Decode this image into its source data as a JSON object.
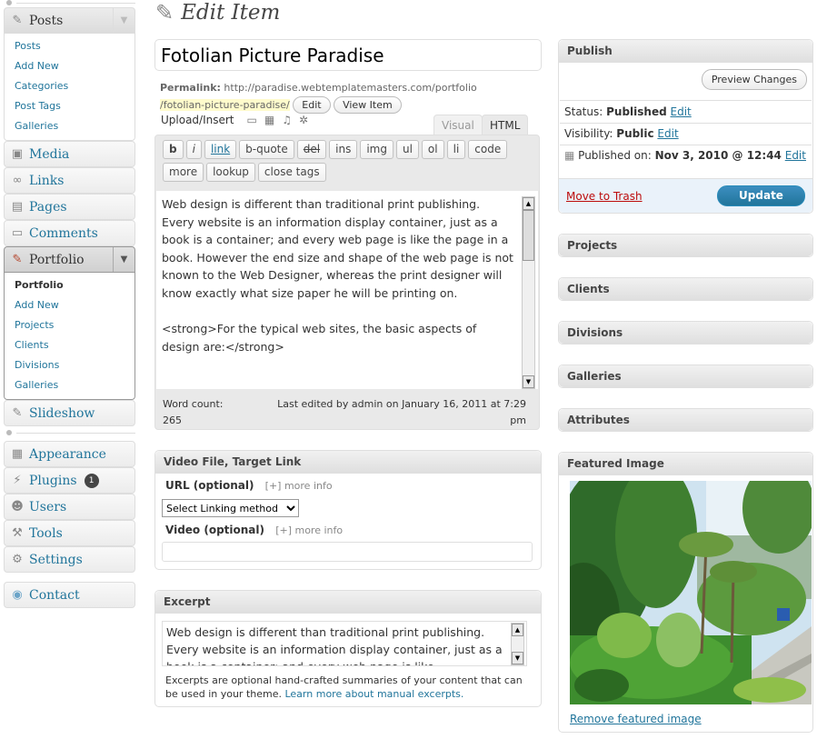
{
  "sidebar": {
    "posts": {
      "label": "Posts",
      "items": [
        "Posts",
        "Add New",
        "Categories",
        "Post Tags",
        "Galleries"
      ]
    },
    "media": "Media",
    "links": "Links",
    "pages": "Pages",
    "comments": "Comments",
    "portfolio": {
      "label": "Portfolio",
      "items": [
        "Portfolio",
        "Add New",
        "Projects",
        "Clients",
        "Divisions",
        "Galleries"
      ]
    },
    "slideshow": "Slideshow",
    "appearance": "Appearance",
    "plugins": "Plugins",
    "plugins_badge": "1",
    "users": "Users",
    "tools": "Tools",
    "settings": "Settings",
    "contact": "Contact"
  },
  "page_title": "Edit Item",
  "post": {
    "title": "Fotolian Picture Paradise",
    "permalink_label": "Permalink:",
    "permalink_base": "http://paradise.webtemplatemasters.com/portfolio",
    "permalink_slug": "/fotolian-picture-paradise/",
    "edit_button": "Edit",
    "view_button": "View Item",
    "upload_insert": "Upload/Insert",
    "tab_visual": "Visual",
    "tab_html": "HTML",
    "quicktags": [
      "b",
      "i",
      "link",
      "b-quote",
      "del",
      "ins",
      "img",
      "ul",
      "ol",
      "li",
      "code",
      "more",
      "lookup",
      "close tags"
    ],
    "content": "Web design is different than traditional print publishing. Every website is an information display container, just as a book is a container; and every web page is like the page in a book. However the end size and shape of the web page is not known to the Web Designer, whereas the print designer will know exactly what size paper he will be printing on.\n\n<strong>For the typical web sites, the basic aspects of design are:</strong>",
    "word_count_label": "Word count:",
    "word_count": "265",
    "last_edited": "Last edited by admin on January 16, 2011 at 7:29 pm"
  },
  "video_box": {
    "title": "Video File, Target Link",
    "url_label": "URL (optional)",
    "url_more": "[+] more info",
    "select_value": "Select Linking method",
    "video_label": "Video (optional)",
    "video_more": "[+] more info"
  },
  "excerpt_box": {
    "title": "Excerpt",
    "text": "Web design is different than traditional print publishing. Every website is an information display container, just as a book is a container; and every web page is like",
    "help": "Excerpts are optional hand-crafted summaries of your content that can be used in your theme.",
    "help_link": "Learn more about manual excerpts."
  },
  "publish_box": {
    "title": "Publish",
    "preview_button": "Preview Changes",
    "status_label": "Status:",
    "status_value": "Published",
    "visibility_label": "Visibility:",
    "visibility_value": "Public",
    "published_label": "Published on:",
    "published_value": "Nov 3, 2010 @ 12:44",
    "edit_link": "Edit",
    "trash_link": "Move to Trash",
    "update_button": "Update"
  },
  "side_boxes": [
    "Projects",
    "Clients",
    "Divisions",
    "Galleries",
    "Attributes"
  ],
  "featured_box": {
    "title": "Featured Image",
    "remove_link": "Remove featured image"
  },
  "colors": {
    "link": "#21759b",
    "update_button": "#21759b",
    "trash": "#bc0b0b",
    "slug_highlight": "#fffbcc"
  }
}
